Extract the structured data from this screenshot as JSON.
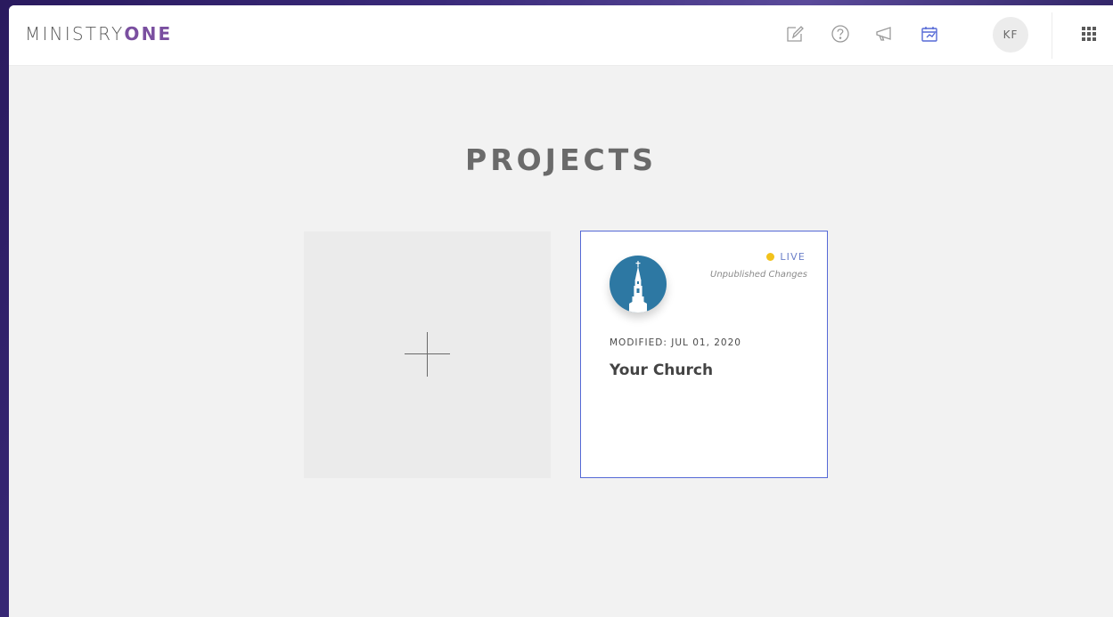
{
  "app": {
    "logo_main": "MINISTRY",
    "logo_accent": "ONE"
  },
  "header": {
    "icons": [
      "edit-note-icon",
      "help-icon",
      "megaphone-icon",
      "projects-icon"
    ],
    "active_icon": "projects-icon",
    "avatar_initials": "KF",
    "apps_icon": "apps-grid-icon",
    "accent_color": "#5569d6"
  },
  "main": {
    "title": "PROJECTS",
    "new_project_icon": "plus-icon",
    "projects": [
      {
        "status": "LIVE",
        "status_color": "#f2c21b",
        "changes_note": "Unpublished Changes",
        "modified": "MODIFIED: JUL 01, 2020",
        "name": "Your Church",
        "logo_icon": "church-steeple-icon",
        "logo_color": "#2d78a3"
      }
    ]
  }
}
